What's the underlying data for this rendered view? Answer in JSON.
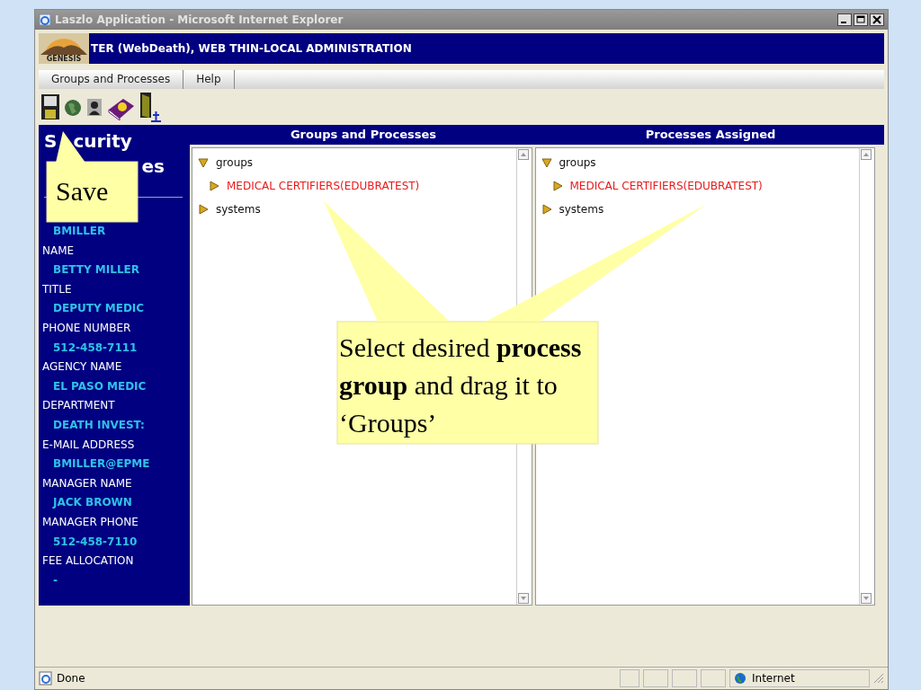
{
  "window": {
    "title": "Laszlo Application - Microsoft Internet Explorer"
  },
  "app_header": {
    "title": "TER (WebDeath), WEB THIN-LOCAL ADMINISTRATION",
    "logo_text": "GENESIS"
  },
  "menu": [
    {
      "label": "Groups and Processes"
    },
    {
      "label": "Help"
    }
  ],
  "sidebar": {
    "title_lines": [
      [
        "S",
        "curity"
      ],
      [
        "es"
      ]
    ],
    "fields": [
      {
        "value": "BMILLER"
      },
      {
        "label": "NAME",
        "value": "BETTY MILLER"
      },
      {
        "label": "TITLE",
        "value": "DEPUTY MEDIC"
      },
      {
        "label": "PHONE NUMBER",
        "value": "512-458-7111"
      },
      {
        "label": "AGENCY NAME",
        "value": "EL PASO MEDIC"
      },
      {
        "label": "DEPARTMENT",
        "value": "DEATH INVEST:"
      },
      {
        "label": "E-MAIL ADDRESS",
        "value": "BMILLER@EPME"
      },
      {
        "label": "MANAGER NAME",
        "value": "JACK BROWN"
      },
      {
        "label": "MANAGER PHONE",
        "value": "512-458-7110"
      },
      {
        "label": "FEE ALLOCATION",
        "value": "-"
      }
    ]
  },
  "panes": [
    {
      "title": "Groups and Processes",
      "nodes": [
        {
          "label": "groups",
          "expanded": true,
          "highlighted": false,
          "children": [
            {
              "label": "MEDICAL CERTIFIERS(EDUBRATEST)",
              "expanded": false,
              "highlighted": true
            }
          ]
        },
        {
          "label": "systems",
          "expanded": false,
          "highlighted": false
        }
      ]
    },
    {
      "title": "Processes Assigned",
      "nodes": [
        {
          "label": "groups",
          "expanded": true,
          "highlighted": false,
          "children": [
            {
              "label": "MEDICAL CERTIFIERS(EDUBRATEST)",
              "expanded": false,
              "highlighted": true
            }
          ]
        },
        {
          "label": "systems",
          "expanded": false,
          "highlighted": false
        }
      ]
    }
  ],
  "callouts": [
    {
      "kind": "small",
      "text": "Save"
    },
    {
      "kind": "large",
      "text": "Select desired **process group** and drag it to ‘Groups’"
    }
  ],
  "status_bar": {
    "text": "Done",
    "zone": "Internet"
  }
}
